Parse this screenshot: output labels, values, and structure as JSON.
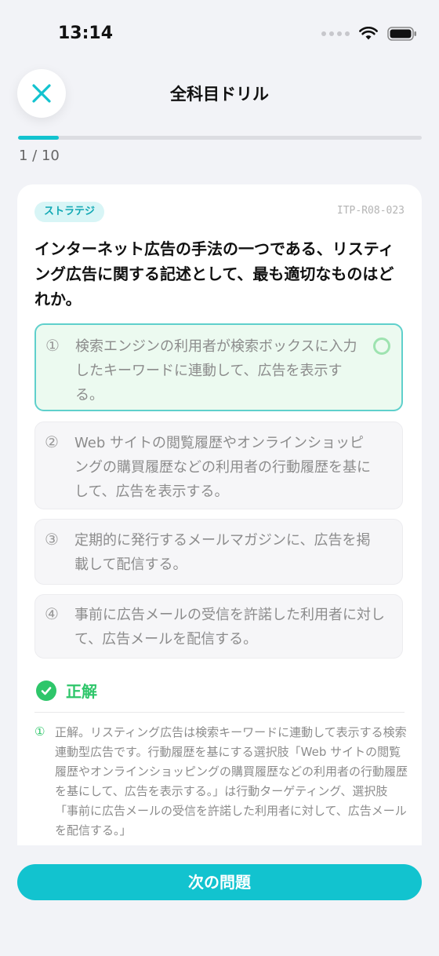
{
  "status_bar": {
    "time": "13:14"
  },
  "header": {
    "title": "全科目ドリル"
  },
  "progress": {
    "fraction": 0.1,
    "label": "1 / 10"
  },
  "question": {
    "category": "ストラテジ",
    "id": "ITP-R08-023",
    "text": "インターネット広告の手法の一つである、リスティング広告に関する記述として、最も適切なものはどれか。",
    "options": [
      {
        "num": "①",
        "text": "検索エンジンの利用者が検索ボックスに入力したキーワードに連動して、広告を表示する。"
      },
      {
        "num": "②",
        "text": "Web サイトの閲覧履歴やオンラインショッピングの購買履歴などの利用者の行動履歴を基にして、広告を表示する。"
      },
      {
        "num": "③",
        "text": "定期的に発行するメールマガジンに、広告を掲載して配信する。"
      },
      {
        "num": "④",
        "text": "事前に広告メールの受信を許諾した利用者に対して、広告メールを配信する。"
      }
    ]
  },
  "result": {
    "label": "正解"
  },
  "explanation": {
    "num": "①",
    "text": "正解。リスティング広告は検索キーワードに連動して表示する検索連動型広告です。行動履歴を基にする選択肢「Web サイトの閲覧履歴やオンラインショッピングの購買履歴などの利用者の行動履歴を基にして、広告を表示する。」は行動ターゲティング、選択肢「事前に広告メールの受信を許諾した利用者に対して、広告メールを配信する。」"
  },
  "footer": {
    "next_label": "次の問題"
  },
  "colors": {
    "accent": "#12c3cf",
    "correct": "#2ec66a"
  }
}
